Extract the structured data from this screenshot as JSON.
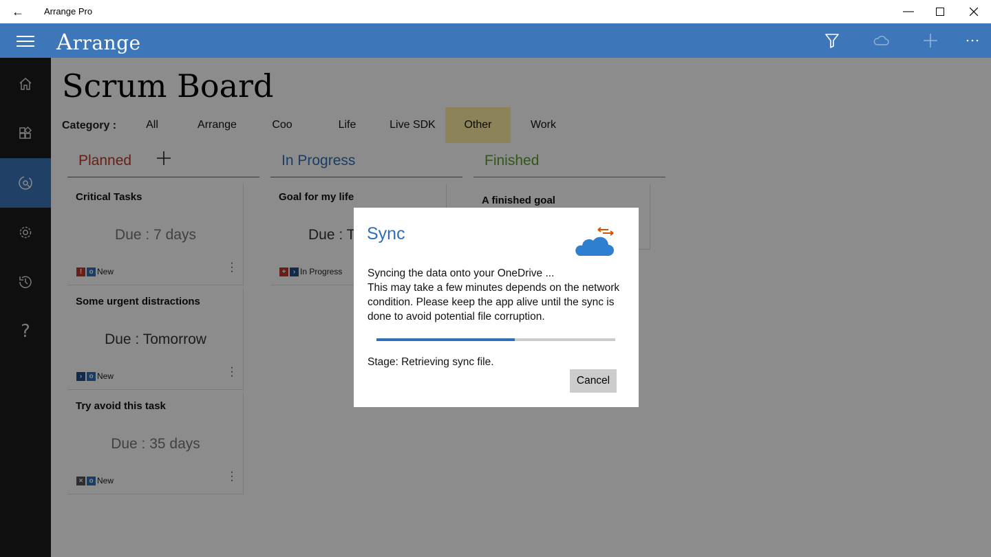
{
  "window": {
    "title": "Arrange Pro",
    "controls": [
      "minimize-icon",
      "maximize-icon",
      "close-icon"
    ]
  },
  "appbar": {
    "brand_initial": "A",
    "brand_rest": "rrange",
    "actions": [
      {
        "name": "filter-icon",
        "enabled": true
      },
      {
        "name": "cloud-sync-icon",
        "enabled": false
      },
      {
        "name": "add-icon",
        "enabled": false
      },
      {
        "name": "more-icon",
        "enabled": true
      }
    ],
    "accent_color": "#3d76b9"
  },
  "sidenav": {
    "items": [
      {
        "icon": "home-icon",
        "active": false
      },
      {
        "icon": "widgets-icon",
        "active": false
      },
      {
        "icon": "scrum-board-icon",
        "active": true
      },
      {
        "icon": "settings-icon",
        "active": false
      },
      {
        "icon": "history-icon",
        "active": false
      },
      {
        "icon": "help-icon",
        "active": false
      }
    ]
  },
  "page": {
    "title": "Scrum Board",
    "category_label": "Category :",
    "categories": [
      "All",
      "Arrange",
      "Coo",
      "Life",
      "Live SDK",
      "Other",
      "Work"
    ],
    "selected_category": "Other"
  },
  "columns": [
    {
      "label": "Planned",
      "color": "#c0392b",
      "has_add": true,
      "cards": [
        {
          "title": "Critical Tasks",
          "due": "Due : 7 days",
          "priority": "urgent",
          "status": "New"
        },
        {
          "title": "Some urgent distractions",
          "due": "Due : Tomorrow",
          "priority": "next",
          "status": "New"
        },
        {
          "title": "Try avoid this task",
          "due": "Due : 35 days",
          "priority": "avoid",
          "status": "New"
        }
      ]
    },
    {
      "label": "In Progress",
      "color": "#2f6fb8",
      "has_add": false,
      "cards": [
        {
          "title": "Goal for my life",
          "due": "Due : T",
          "priority": "important",
          "status": "In Progress"
        }
      ]
    },
    {
      "label": "Finished",
      "color": "#5aa02c",
      "has_add": false,
      "cards": [
        {
          "title": "A finished goal",
          "due": "",
          "priority": "",
          "status": ""
        }
      ]
    }
  ],
  "dialog": {
    "title": "Sync",
    "line1": "Syncing the data onto your OneDrive ...",
    "line2": "This may take a few minutes depends on the network",
    "line3": "condition. Please keep the app alive until the sync is",
    "line4": "done to avoid potential file corruption.",
    "progress": 0.58,
    "stage": "Stage: Retrieving sync file.",
    "cancel_label": "Cancel",
    "icon": "onedrive-sync-icon"
  }
}
